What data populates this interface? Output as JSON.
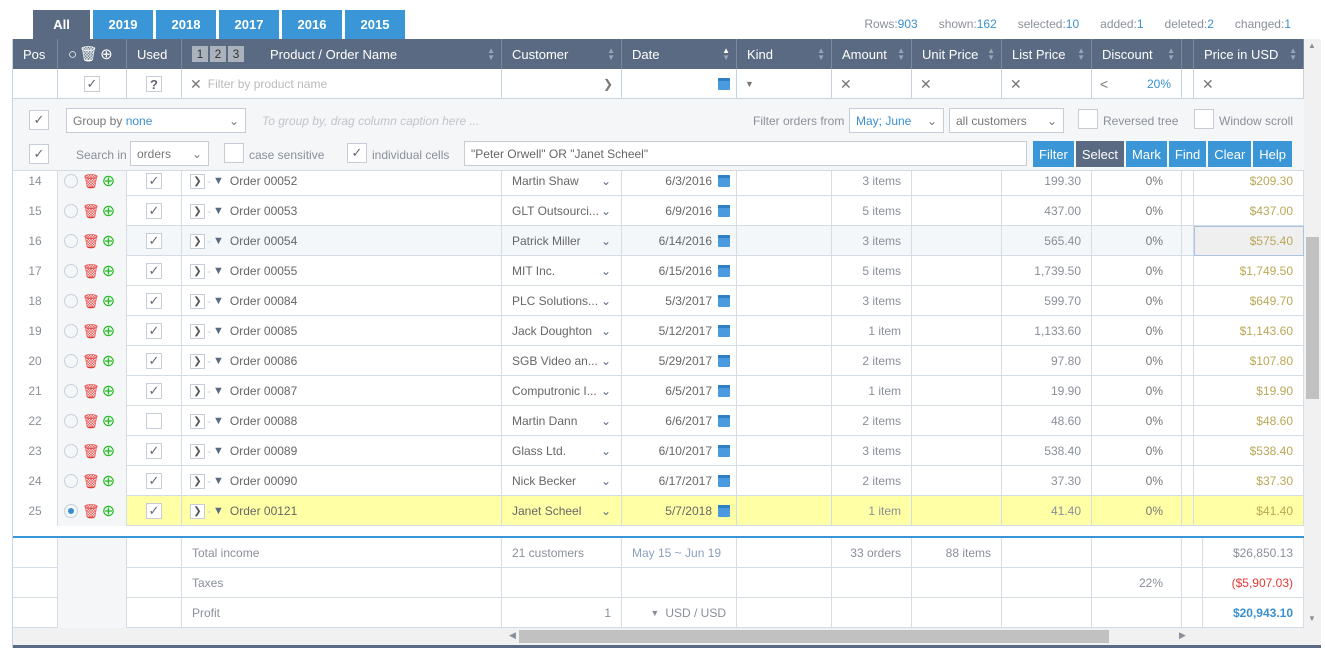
{
  "tabs": [
    "All",
    "2019",
    "2018",
    "2017",
    "2016",
    "2015"
  ],
  "stats": [
    {
      "label": "Rows:",
      "value": "903"
    },
    {
      "label": "shown:",
      "value": "162"
    },
    {
      "label": "selected:",
      "value": "10"
    },
    {
      "label": "added:",
      "value": "1"
    },
    {
      "label": "deleted:",
      "value": "2"
    },
    {
      "label": "changed:",
      "value": "1"
    }
  ],
  "columns": [
    "Pos",
    "",
    "Used",
    "Product / Order Name",
    "Customer",
    "Date",
    "Kind",
    "Amount",
    "Unit Price",
    "List Price",
    "Discount",
    "",
    "Price in USD"
  ],
  "levels": [
    "1",
    "2",
    "3"
  ],
  "filter": {
    "product_placeholder": "Filter by product name",
    "used": "?",
    "discount_op": "<",
    "discount_value": "20%"
  },
  "toolbar": {
    "group_by_label": "Group by",
    "group_by_value": "none",
    "group_hint": "To group by, drag column caption here ...",
    "filter_from_label": "Filter orders from",
    "filter_from_value": "May; June",
    "customers_value": "all customers",
    "reversed_tree": "Reversed tree",
    "window_scroll": "Window scroll",
    "search_in_label": "Search in",
    "search_in_value": "orders",
    "case_sensitive": "case sensitive",
    "individual_cells": "individual cells",
    "search_value": "\"Peter Orwell\" OR \"Janet Scheel\"",
    "buttons": [
      "Filter",
      "Select",
      "Mark",
      "Find",
      "Clear",
      "Help"
    ]
  },
  "rows": [
    {
      "pos": "14",
      "used": true,
      "name": "Order 00052",
      "customer": "Martin Shaw",
      "date": "6/3/2016",
      "amount": "3 items",
      "list": "199.30",
      "disc": "0%",
      "usd": "$209.30"
    },
    {
      "pos": "15",
      "used": true,
      "name": "Order 00053",
      "customer": "GLT Outsourci...",
      "date": "6/9/2016",
      "amount": "5 items",
      "list": "437.00",
      "disc": "0%",
      "usd": "$437.00"
    },
    {
      "pos": "16",
      "used": true,
      "name": "Order 00054",
      "customer": "Patrick Miller",
      "date": "6/14/2016",
      "amount": "3 items",
      "list": "565.40",
      "disc": "0%",
      "usd": "$575.40"
    },
    {
      "pos": "17",
      "used": true,
      "name": "Order 00055",
      "customer": "MIT Inc.",
      "date": "6/15/2016",
      "amount": "5 items",
      "list": "1,739.50",
      "disc": "0%",
      "usd": "$1,749.50"
    },
    {
      "pos": "18",
      "used": true,
      "name": "Order 00084",
      "customer": "PLC Solutions...",
      "date": "5/3/2017",
      "amount": "3 items",
      "list": "599.70",
      "disc": "0%",
      "usd": "$649.70"
    },
    {
      "pos": "19",
      "used": true,
      "name": "Order 00085",
      "customer": "Jack Doughton",
      "date": "5/12/2017",
      "amount": "1 item",
      "list": "1,133.60",
      "disc": "0%",
      "usd": "$1,143.60"
    },
    {
      "pos": "20",
      "used": true,
      "name": "Order 00086",
      "customer": "SGB Video an...",
      "date": "5/29/2017",
      "amount": "2 items",
      "list": "97.80",
      "disc": "0%",
      "usd": "$107.80"
    },
    {
      "pos": "21",
      "used": true,
      "name": "Order 00087",
      "customer": "Computronic I...",
      "date": "6/5/2017",
      "amount": "1 item",
      "list": "19.90",
      "disc": "0%",
      "usd": "$19.90"
    },
    {
      "pos": "22",
      "used": false,
      "name": "Order 00088",
      "customer": "Martin Dann",
      "date": "6/6/2017",
      "amount": "2 items",
      "list": "48.60",
      "disc": "0%",
      "usd": "$48.60"
    },
    {
      "pos": "23",
      "used": true,
      "name": "Order 00089",
      "customer": "Glass Ltd.",
      "date": "6/10/2017",
      "amount": "3 items",
      "list": "538.40",
      "disc": "0%",
      "usd": "$538.40"
    },
    {
      "pos": "24",
      "used": true,
      "name": "Order 00090",
      "customer": "Nick Becker",
      "date": "6/17/2017",
      "amount": "2 items",
      "list": "37.30",
      "disc": "0%",
      "usd": "$37.30"
    },
    {
      "pos": "25",
      "used": true,
      "name": "Order 00121",
      "customer": "Janet Scheel",
      "date": "5/7/2018",
      "amount": "1 item",
      "list": "41.40",
      "disc": "0%",
      "usd": "$41.40",
      "selected": true
    }
  ],
  "footer": {
    "total_label": "Total income",
    "customers": "21 customers",
    "date_range": "May 15 ~ Jun 19",
    "orders": "33 orders",
    "items": "88 items",
    "total": "$26,850.13",
    "taxes_label": "Taxes",
    "tax_rate": "22%",
    "taxes": "($5,907.03)",
    "profit_label": "Profit",
    "profit_count": "1",
    "currency": "USD / USD",
    "profit": "$20,943.10"
  },
  "colors": {
    "header": "#5a6a82",
    "accent": "#3a96d6",
    "selected_row": "#ffffa6",
    "negative": "#e53935",
    "price": "#b9a858"
  }
}
